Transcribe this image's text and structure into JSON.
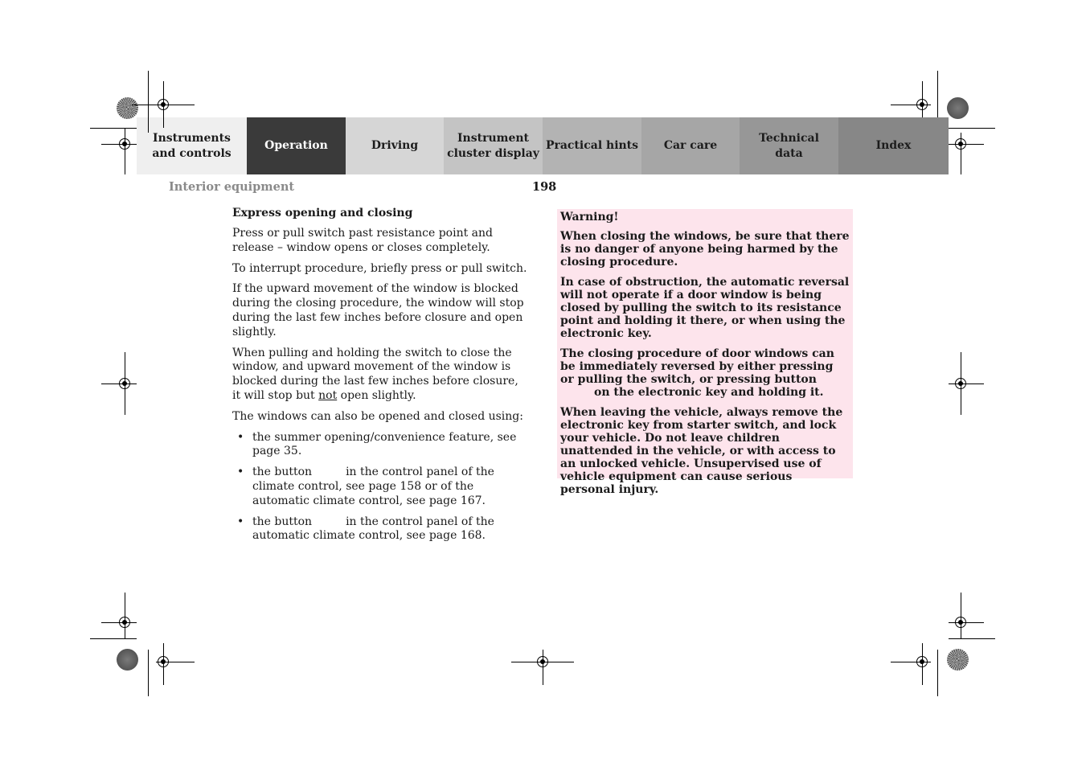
{
  "nav": {
    "tabs": [
      {
        "label_lines": [
          "Instruments",
          "and controls"
        ],
        "active": false
      },
      {
        "label_lines": [
          "Operation"
        ],
        "active": true
      },
      {
        "label_lines": [
          "Driving"
        ],
        "active": false
      },
      {
        "label_lines": [
          "Instrument",
          "cluster display"
        ],
        "active": false
      },
      {
        "label_lines": [
          "Practical hints"
        ],
        "active": false
      },
      {
        "label_lines": [
          "Car care"
        ],
        "active": false
      },
      {
        "label_lines": [
          "Technical",
          "data"
        ],
        "active": false
      },
      {
        "label_lines": [
          "Index"
        ],
        "active": false
      }
    ]
  },
  "header": {
    "section_title": "Interior equipment",
    "page_number": "198"
  },
  "left": {
    "heading": "Express opening and closing",
    "paragraphs": [
      "Press or pull switch past resistance point and release – window opens or closes completely.",
      "To interrupt procedure, briefly press or pull switch.",
      "If the upward movement of the window is blocked during the closing procedure, the window will stop during the last few inches before closure and open slightly."
    ],
    "para4": {
      "before": "When pulling and holding the switch to close the window, and upward movement of the window is blocked during the last few inches before closure, it will stop but ",
      "underlined": "not",
      "after": " open slightly."
    },
    "intro": "The windows can also be opened and closed using:",
    "bullet_glyph": "•",
    "bullets": [
      {
        "before": "the summer opening/convenience feature, see page 35.",
        "after": ""
      },
      {
        "before": "the button",
        "after": "in the control panel of the climate control, see page 158 or of the automatic climate control, see page 167."
      },
      {
        "before": "the button",
        "after": "in the control panel of the automatic climate control, see page 168."
      }
    ]
  },
  "warning": {
    "title": "Warning!",
    "p1": "When closing the windows, be sure that there is no danger of anyone being harmed by the closing procedure.",
    "p2": "In case of obstruction, the automatic reversal will not operate if a door window is being closed by pulling the switch to its resistance point and holding it there, or when using the electronic key.",
    "p3_before": "The closing procedure of door windows can be immediately reversed by either pressing or pulling the switch, or pressing button",
    "p3_after": "on the electronic key and holding it.",
    "p4": "When leaving the vehicle, always remove the electronic key from starter switch, and lock your vehicle. Do not leave children unattended in the vehicle, or with access to an unlocked vehicle. Unsupervised use of vehicle equipment can cause serious personal injury."
  },
  "colors": {
    "active_tab": "#3a3a3a",
    "warning_bg": "#fde4ec",
    "section_title": "#8a8a8a"
  }
}
